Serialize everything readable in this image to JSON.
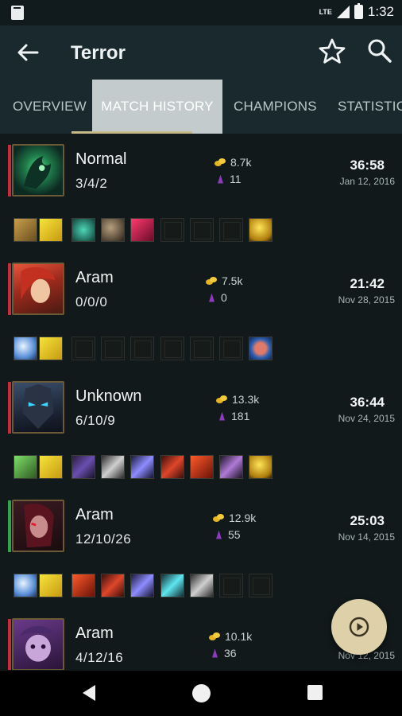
{
  "status_bar": {
    "network": "LTE",
    "time": "1:32"
  },
  "app_bar": {
    "title": "Terror",
    "back_icon": "arrow-left-icon",
    "favorite_icon": "star-outline-icon",
    "search_icon": "search-icon"
  },
  "tabs": [
    {
      "label": "OVERVIEW",
      "active": false
    },
    {
      "label": "MATCH HISTORY",
      "active": true
    },
    {
      "label": "CHAMPIONS",
      "active": false
    },
    {
      "label": "STATISTICS",
      "active": false
    }
  ],
  "colors": {
    "loss": "#c62d3c",
    "win": "#33a24a",
    "accent": "#c8b98b",
    "fab": "#ded0a8"
  },
  "matches": [
    {
      "mode": "Normal",
      "kda": "3/4/2",
      "gold": "8.7k",
      "cs": "11",
      "duration": "36:58",
      "date": "Jan 12, 2016",
      "result": "loss",
      "champion_icon": "thresh-icon",
      "items": [
        "spell-icon",
        "ward-icon",
        "jade-potion-icon",
        "tooth-icon",
        "crystal-icon",
        "empty",
        "empty",
        "empty",
        "trinket-icon"
      ]
    },
    {
      "mode": "Aram",
      "kda": "0/0/0",
      "gold": "7.5k",
      "cs": "0",
      "duration": "21:42",
      "date": "Nov 28, 2015",
      "result": "loss",
      "champion_icon": "katarina-icon",
      "items": [
        "snowball-icon",
        "ward-icon",
        "empty",
        "empty",
        "empty",
        "empty",
        "empty",
        "empty",
        "brain-icon"
      ]
    },
    {
      "mode": "Unknown",
      "kda": "6/10/9",
      "gold": "13.3k",
      "cs": "181",
      "duration": "36:44",
      "date": "Nov 24, 2015",
      "result": "loss",
      "champion_icon": "kassadin-icon",
      "items": [
        "spell-icon",
        "ward-icon",
        "sword-icon",
        "axe-icon",
        "spear-icon",
        "hammer-icon",
        "blade-icon",
        "dagger-icon",
        "trinket-icon"
      ]
    },
    {
      "mode": "Aram",
      "kda": "12/10/26",
      "gold": "12.9k",
      "cs": "55",
      "duration": "25:03",
      "date": "Nov 14, 2015",
      "result": "win",
      "champion_icon": "akali-icon",
      "items": [
        "snowball-icon",
        "ward-icon",
        "blade-icon",
        "hammer-icon",
        "spear-icon",
        "staff-icon",
        "axe-icon",
        "empty",
        "empty"
      ]
    },
    {
      "mode": "Aram",
      "kda": "4/12/16",
      "gold": "10.1k",
      "cs": "36",
      "duration": "",
      "date": "Nov 12, 2015",
      "result": "loss",
      "champion_icon": "poppy-icon",
      "items": []
    }
  ],
  "fab": {
    "icon": "play-icon"
  },
  "nav": {
    "back_icon": "nav-back-icon",
    "home_icon": "nav-home-icon",
    "recents_icon": "nav-recents-icon"
  }
}
